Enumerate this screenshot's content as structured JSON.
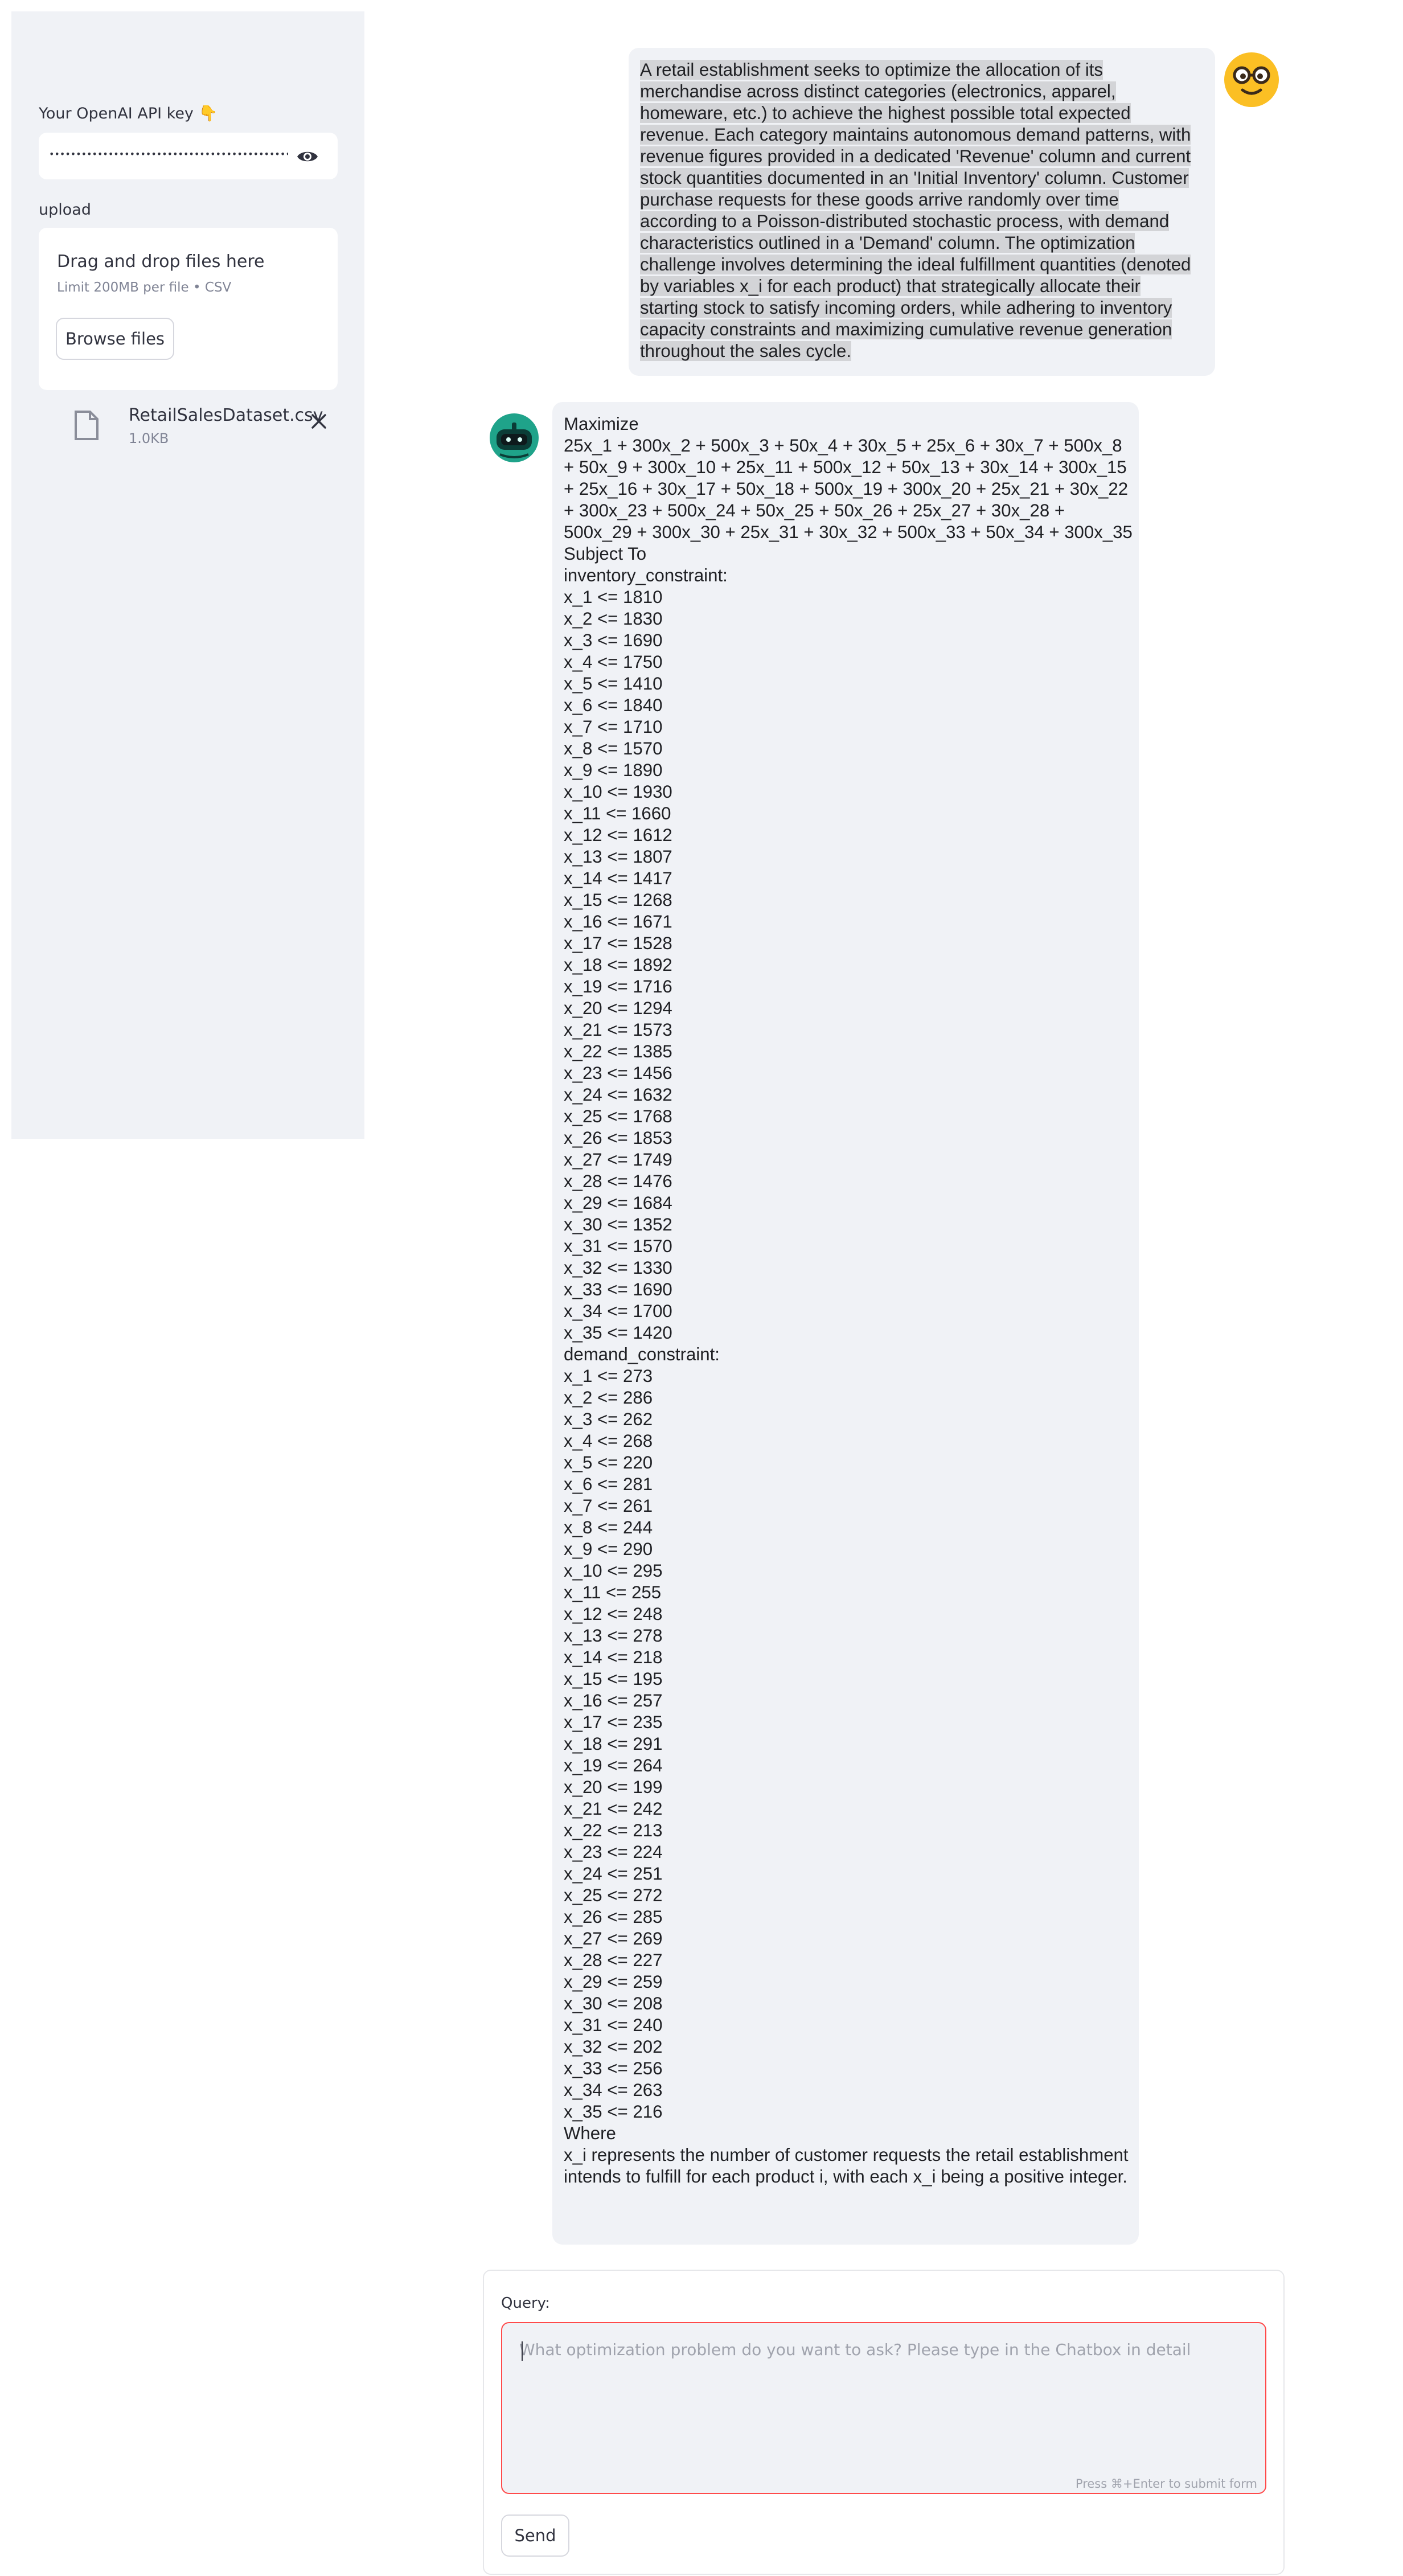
{
  "sidebar": {
    "api_key_label": "Your OpenAI API key 👇",
    "api_key_masked": "••••••••••••••••••••••••••••••••••••••••••••••••••••",
    "upload_label": "upload",
    "drop_title": "Drag and drop files here",
    "drop_limit": "Limit 200MB per file • CSV",
    "browse_label": "Browse files",
    "file": {
      "name": "RetailSalesDataset.csv",
      "size": "1.0KB"
    }
  },
  "chat": {
    "user_message": "A retail establishment seeks to optimize the allocation of its merchandise across distinct categories (electronics, apparel, homeware, etc.) to achieve the highest possible total expected revenue. Each category maintains autonomous demand patterns, with revenue figures provided in a dedicated 'Revenue' column and current stock quantities documented in an 'Initial Inventory' column. Customer purchase requests for these goods arrive randomly over time according to a Poisson-distributed stochastic process, with demand characteristics outlined in a 'Demand' column. The optimization challenge involves determining the ideal fulfillment quantities (denoted by variables x_i for each product) that strategically allocate their starting stock to satisfy incoming orders, while adhering to inventory capacity constraints and maximizing cumulative revenue generation throughout the sales cycle.",
    "bot_lines": [
      "Maximize",
      "25x_1 + 300x_2 + 500x_3 + 50x_4 + 30x_5 + 25x_6 + 30x_7 + 500x_8 + 50x_9 + 300x_10 + 25x_11 + 500x_12 + 50x_13 + 30x_14 + 300x_15 + 25x_16 + 30x_17 + 50x_18 + 500x_19 + 300x_20 + 25x_21 + 30x_22 + 300x_23 + 500x_24 + 50x_25 + 50x_26 + 25x_27 + 30x_28 + 500x_29 + 300x_30 + 25x_31 + 30x_32 + 500x_33 + 50x_34 + 300x_35",
      "Subject To",
      "inventory_constraint:",
      "x_1 <= 1810",
      "x_2 <= 1830",
      "x_3 <= 1690",
      "x_4 <= 1750",
      "x_5 <= 1410",
      "x_6 <= 1840",
      "x_7 <= 1710",
      "x_8 <= 1570",
      "x_9 <= 1890",
      "x_10 <= 1930",
      "x_11 <= 1660",
      "x_12 <= 1612",
      "x_13 <= 1807",
      "x_14 <= 1417",
      "x_15 <= 1268",
      "x_16 <= 1671",
      "x_17 <= 1528",
      "x_18 <= 1892",
      "x_19 <= 1716",
      "x_20 <= 1294",
      "x_21 <= 1573",
      "x_22 <= 1385",
      "x_23 <= 1456",
      "x_24 <= 1632",
      "x_25 <= 1768",
      "x_26 <= 1853",
      "x_27 <= 1749",
      "x_28 <= 1476",
      "x_29 <= 1684",
      "x_30 <= 1352",
      "x_31 <= 1570",
      "x_32 <= 1330",
      "x_33 <= 1690",
      "x_34 <= 1700",
      "x_35 <= 1420",
      "demand_constraint:",
      "x_1 <= 273",
      "x_2 <= 286",
      "x_3 <= 262",
      "x_4 <= 268",
      "x_5 <= 220",
      "x_6 <= 281",
      "x_7 <= 261",
      "x_8 <= 244",
      "x_9 <= 290",
      "x_10 <= 295",
      "x_11 <= 255",
      "x_12 <= 248",
      "x_13 <= 278",
      "x_14 <= 218",
      "x_15 <= 195",
      "x_16 <= 257",
      "x_17 <= 235",
      "x_18 <= 291",
      "x_19 <= 264",
      "x_20 <= 199",
      "x_21 <= 242",
      "x_22 <= 213",
      "x_23 <= 224",
      "x_24 <= 251",
      "x_25 <= 272",
      "x_26 <= 285",
      "x_27 <= 269",
      "x_28 <= 227",
      "x_29 <= 259",
      "x_30 <= 208",
      "x_31 <= 240",
      "x_32 <= 202",
      "x_33 <= 256",
      "x_34 <= 263",
      "x_35 <= 216",
      "Where",
      "x_i represents the number of customer requests the retail establishment intends to fulfill for each product i, with each x_i being a positive integer."
    ]
  },
  "form": {
    "query_label": "Query:",
    "placeholder": "What optimization problem do you want to ask? Please type in the Chatbox in detail",
    "submit_hint": "Press ⌘+Enter to submit form",
    "send_label": "Send"
  },
  "colors": {
    "accent": "#ff4b4b",
    "sidebar_bg": "#f0f2f6",
    "avatar_user": "#fbbf24",
    "avatar_bot": "#1fa38a"
  }
}
